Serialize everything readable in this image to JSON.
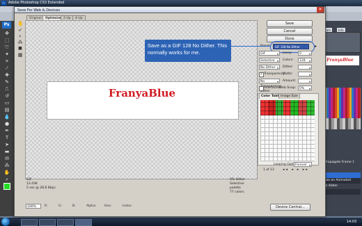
{
  "app": {
    "title": "Adobe Photoshop CS3 Extended",
    "logo": "Ps",
    "clock": "14:03",
    "layers_panel": {
      "propagate_label": "Propagate Frame 1",
      "row_1": "",
      "row_2": "Make an Animated",
      "row_3": "age Adder"
    },
    "mini_preview": "FranyaBlue"
  },
  "dialog": {
    "title": "Save For Web & Devices",
    "close": "✕",
    "tabs": [
      "Original",
      "Optimized",
      "2-Up",
      "4-Up"
    ],
    "active_tab": "Optimized",
    "buttons": {
      "save": "Save",
      "cancel": "Cancel",
      "done": "Done",
      "device_central": "Device Central..."
    },
    "preset": {
      "label": "Preset:",
      "value": "GIF 128 No Dither"
    },
    "settings": {
      "format": "GIF",
      "reduction": "Selective",
      "dither_algo": "No Dither",
      "transparency": "Transparency",
      "transparency_dither": "No Transparency Dither",
      "interlaced": "Interlaced",
      "lossy_label": "Lossy:",
      "lossy_value": "0",
      "colors_label": "Colors:",
      "colors_value": "128",
      "dither_label": "Dither:",
      "matte_label": "Matte:",
      "amount_label": "Amount:",
      "web_snap_label": "Web Snap:",
      "web_snap_value": "0%"
    },
    "color_table": {
      "tabs": [
        "Color Table",
        "Image Size"
      ],
      "count": "1 of 13",
      "looping_label": "Looping Options:",
      "looping_value": "Forever"
    },
    "image_text": "FranyaBlue",
    "info_left": [
      "GIF",
      "13.43K",
      "5 sec @ 28.8 Kbps"
    ],
    "info_right": [
      "0% dither",
      "Selective palette",
      "77 colors"
    ],
    "bottom": {
      "zoom": "100%",
      "r": "R:",
      "g": "G:",
      "b": "B:",
      "alpha": "Alpha:",
      "hex": "Hex:",
      "index": "Index:"
    }
  },
  "callout": {
    "text": "Save as a GIF 128 No Dither. This normally works for me."
  },
  "colors": {
    "accent": "#2d63b5",
    "brand_red": "#d21a22"
  }
}
